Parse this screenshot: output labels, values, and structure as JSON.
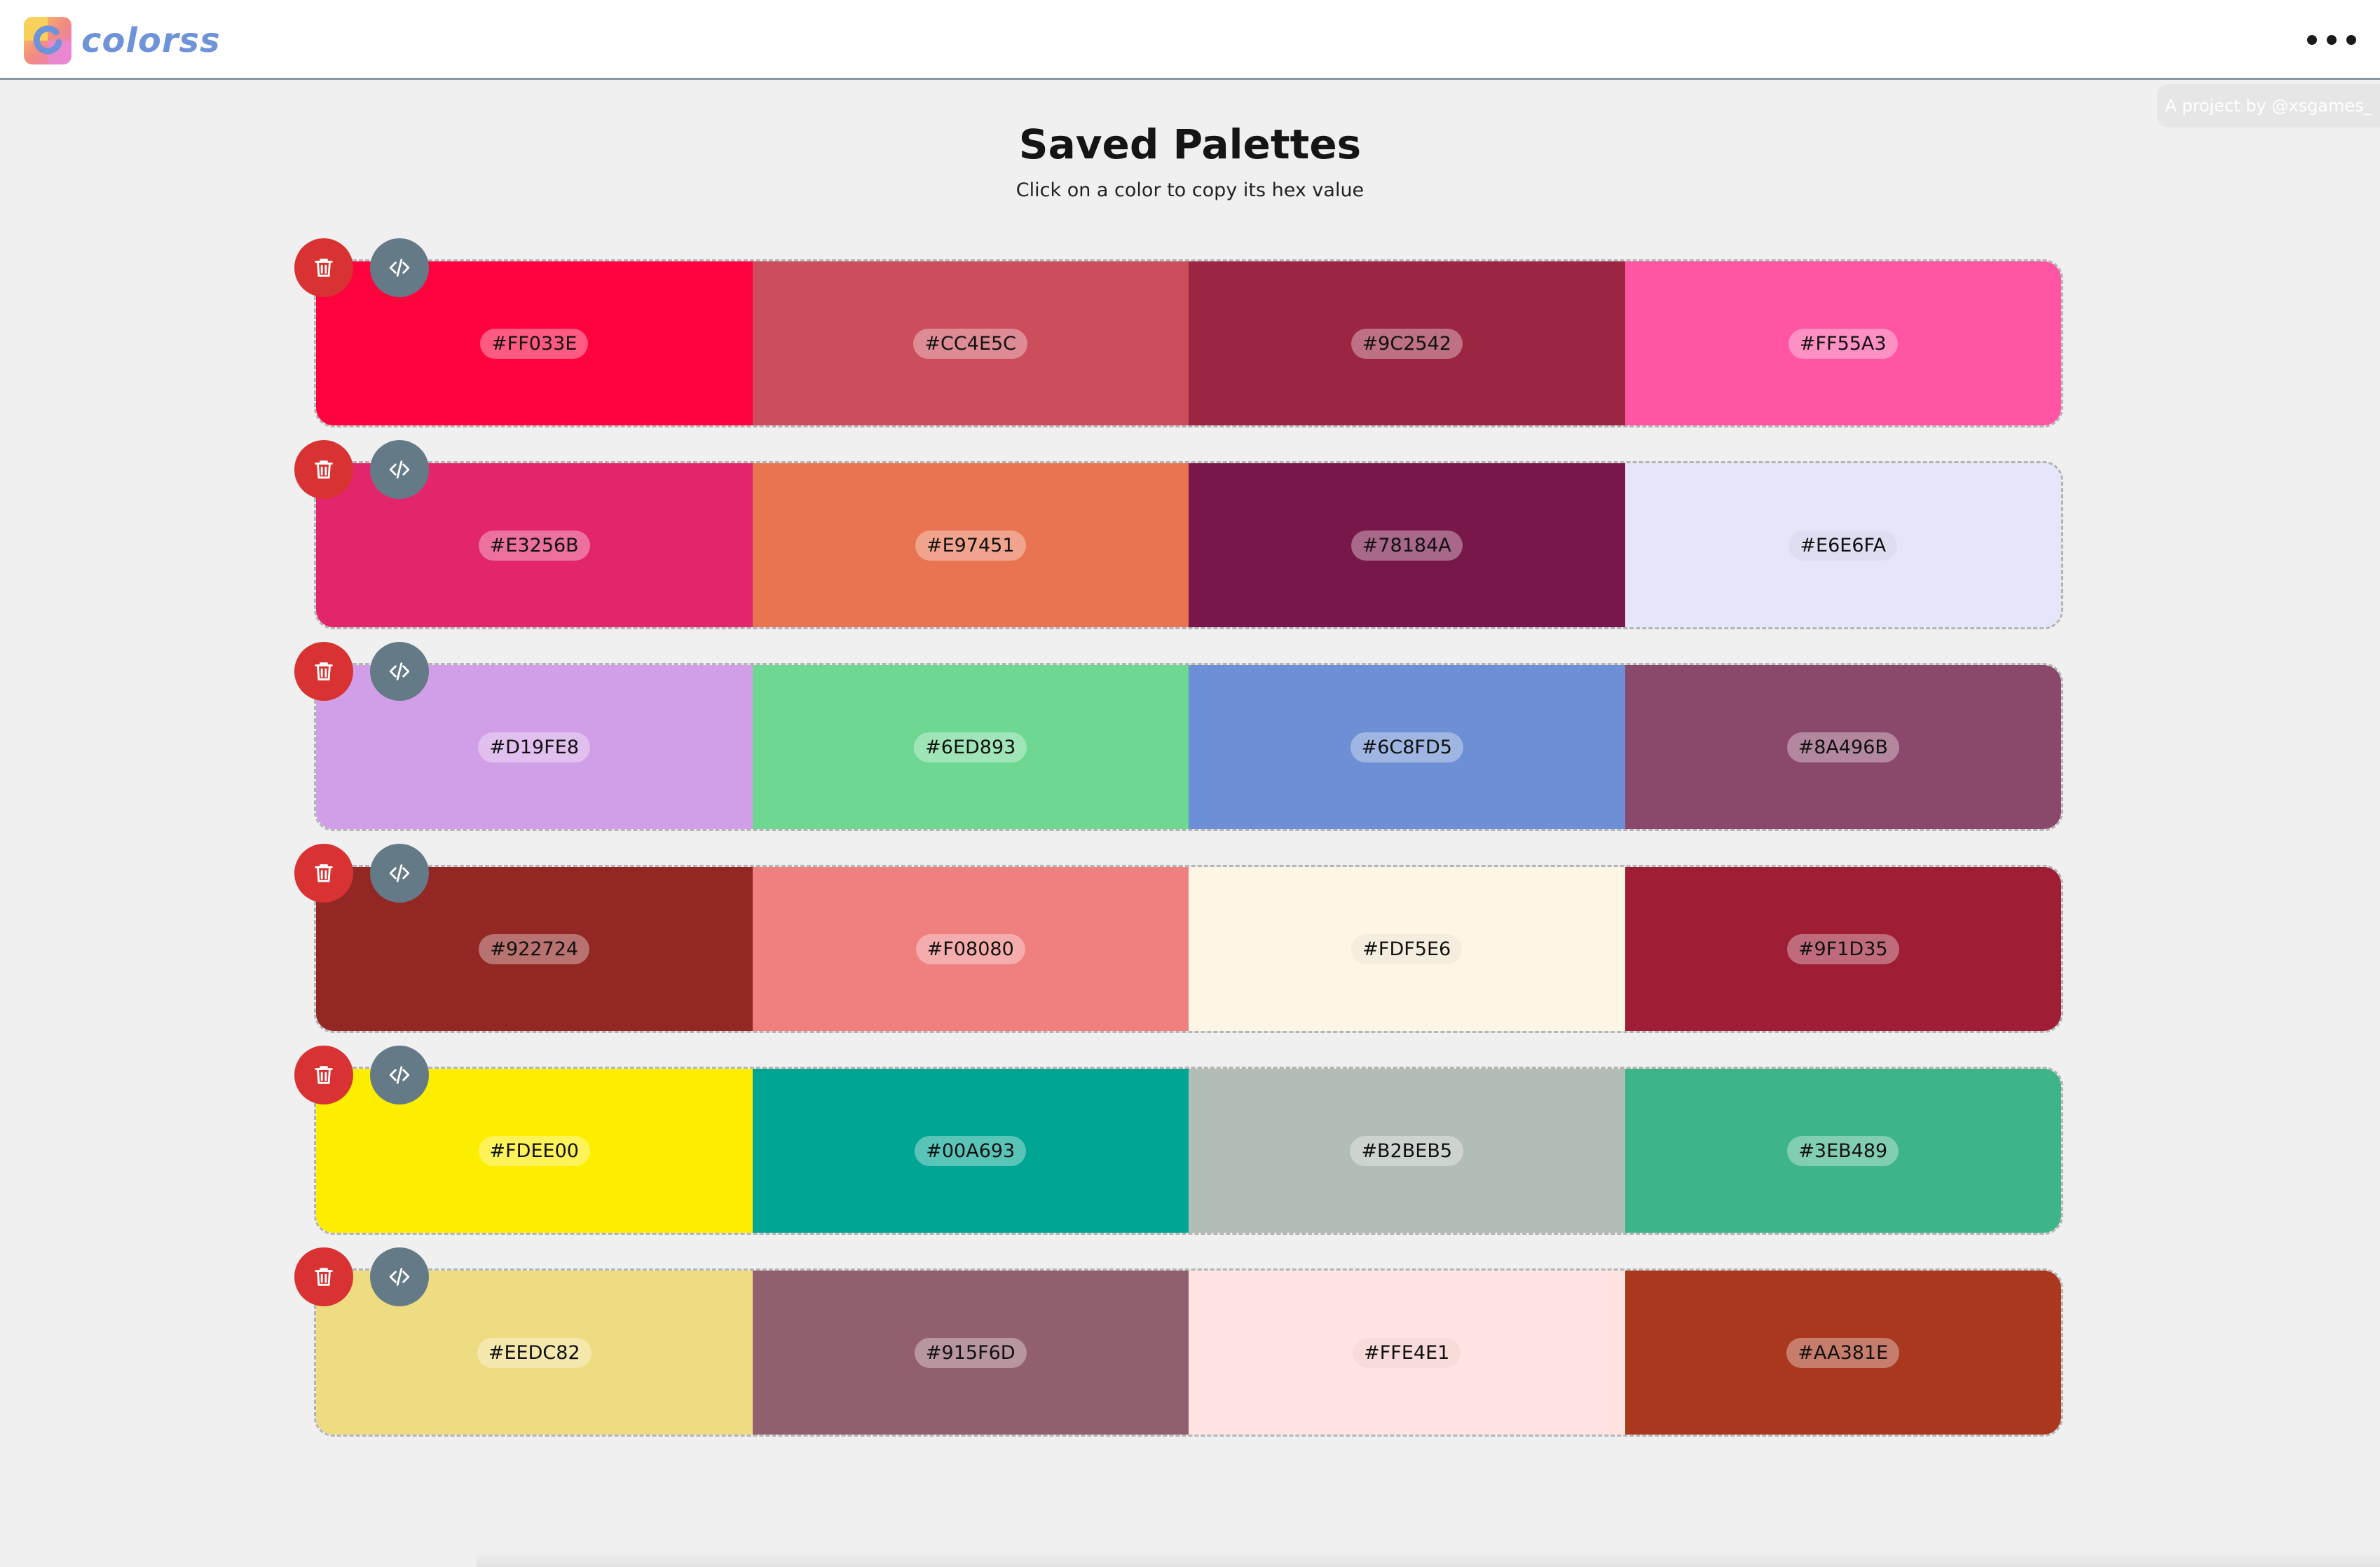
{
  "header": {
    "logo_text": "colorss",
    "menu_icon": "more-horizontal-icon"
  },
  "credit": "A project by @xsgames_",
  "main": {
    "title": "Saved Palettes",
    "subtitle": "Click on a color to copy its hex value"
  },
  "icons": {
    "delete": "trash-icon",
    "code": "code-icon"
  },
  "colors": {
    "delete_button": "#D93232",
    "code_button": "#647A86",
    "background": "#F0F0F0"
  },
  "palettes": [
    {
      "colors": [
        "#FF033E",
        "#CC4E5C",
        "#9C2542",
        "#FF55A3"
      ]
    },
    {
      "colors": [
        "#E3256B",
        "#E97451",
        "#78184A",
        "#E6E6FA"
      ]
    },
    {
      "colors": [
        "#D19FE8",
        "#6ED893",
        "#6C8FD5",
        "#8A496B"
      ]
    },
    {
      "colors": [
        "#922724",
        "#F08080",
        "#FDF5E6",
        "#9F1D35"
      ]
    },
    {
      "colors": [
        "#FDEE00",
        "#00A693",
        "#B2BEB5",
        "#3EB489"
      ]
    },
    {
      "colors": [
        "#EEDC82",
        "#915F6D",
        "#FFE4E1",
        "#AA381E"
      ]
    }
  ]
}
